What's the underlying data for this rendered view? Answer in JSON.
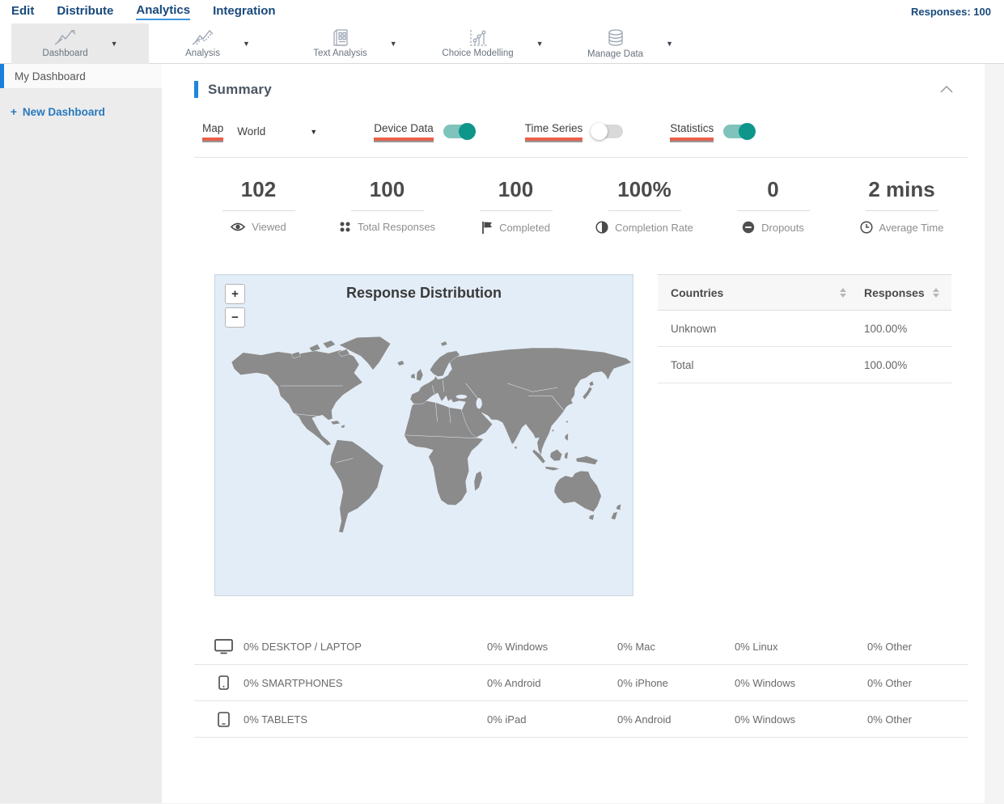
{
  "topnav": {
    "items": [
      {
        "label": "Edit",
        "active": false
      },
      {
        "label": "Distribute",
        "active": false
      },
      {
        "label": "Analytics",
        "active": true
      },
      {
        "label": "Integration",
        "active": false
      }
    ],
    "responses": "Responses: 100"
  },
  "toolbar": {
    "tabs": [
      {
        "label": "Dashboard",
        "icon": "line-chart-icon",
        "active": true
      },
      {
        "label": "Analysis",
        "icon": "analysis-chart-icon",
        "active": false
      },
      {
        "label": "Text Analysis",
        "icon": "text-analysis-icon",
        "active": false
      },
      {
        "label": "Choice Modelling",
        "icon": "choice-modelling-icon",
        "active": false
      },
      {
        "label": "Manage Data",
        "icon": "database-icon",
        "active": false
      }
    ],
    "caret": "▼"
  },
  "sidebar": {
    "active_item": "My Dashboard",
    "new_plus": "+",
    "new_label": "New Dashboard"
  },
  "summary": {
    "title": "Summary",
    "controls": {
      "map_label": "Map",
      "map_value": "World",
      "caret": "▼",
      "toggles": [
        {
          "label": "Device Data",
          "on": true
        },
        {
          "label": "Time Series",
          "on": false
        },
        {
          "label": "Statistics",
          "on": true
        }
      ]
    },
    "stats": [
      {
        "value": "102",
        "label": "Viewed",
        "icon": "eye-icon"
      },
      {
        "value": "100",
        "label": "Total Responses",
        "icon": "dots-grid-icon"
      },
      {
        "value": "100",
        "label": "Completed",
        "icon": "flag-icon"
      },
      {
        "value": "100%",
        "label": "Completion Rate",
        "icon": "half-circle-icon"
      },
      {
        "value": "0",
        "label": "Dropouts",
        "icon": "minus-circle-icon"
      },
      {
        "value": "2 mins",
        "label": "Average Time",
        "icon": "clock-icon"
      }
    ],
    "map": {
      "title": "Response Distribution",
      "zoom_in": "+",
      "zoom_out": "−"
    },
    "countries_table": {
      "col_name": "Countries",
      "col_value": "Responses",
      "rows": [
        {
          "name": "Unknown",
          "value": "100.00%"
        },
        {
          "name": "Total",
          "value": "100.00%"
        }
      ]
    },
    "devices": [
      {
        "icon": "desktop-icon",
        "label": "0% DESKTOP / LAPTOP",
        "cells": [
          "0% Windows",
          "0% Mac",
          "0% Linux",
          "0% Other"
        ]
      },
      {
        "icon": "smartphone-icon",
        "label": "0% SMARTPHONES",
        "cells": [
          "0% Android",
          "0% iPhone",
          "0% Windows",
          "0% Other"
        ]
      },
      {
        "icon": "tablet-icon",
        "label": "0% TABLETS",
        "cells": [
          "0% iPad",
          "0% Android",
          "0% Windows",
          "0% Other"
        ]
      }
    ]
  },
  "colors": {
    "nav_blue": "#17497b",
    "accent_blue": "#1e86e0",
    "link_blue": "#2878be",
    "toggle_on_teal": "#0e968a",
    "underline_red": "#e8604b",
    "map_land": "#8b8b8b",
    "map_sea": "#e3edf7"
  }
}
